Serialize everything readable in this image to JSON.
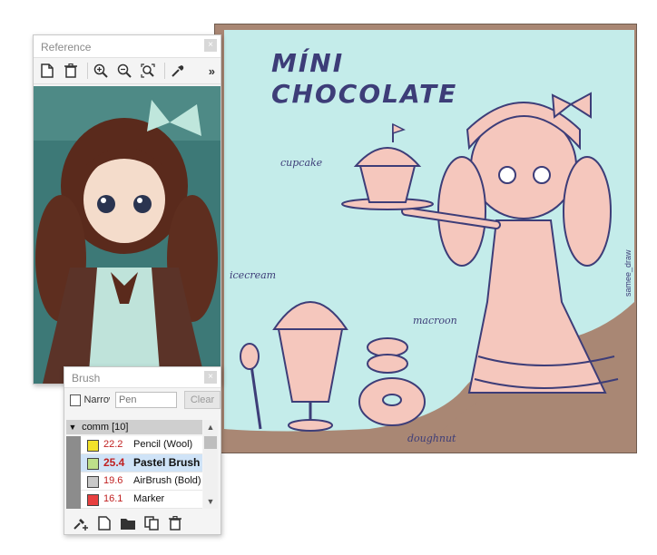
{
  "reference_panel": {
    "title": "Reference",
    "close": "×",
    "toolbar": {
      "icons": [
        "new-page-icon",
        "delete-icon",
        "zoom-in-icon",
        "zoom-out-icon",
        "fit-view-icon",
        "eyedropper-icon"
      ],
      "more": "»"
    }
  },
  "brush_panel": {
    "title": "Brush",
    "close": "×",
    "narrow_label": "Narrow",
    "search_value": "Pen",
    "clear_label": "Clear",
    "group": "comm [10]",
    "items": [
      {
        "size": "22.2",
        "name": "Pencil (Wool)",
        "color": "#f2e22a",
        "selected": false
      },
      {
        "size": "25.4",
        "name": "Pastel Brush",
        "color": "#bde08a",
        "selected": true
      },
      {
        "size": "19.6",
        "name": "AirBrush (Bold)",
        "color": "#c8c8c8",
        "selected": false
      },
      {
        "size": "16.1",
        "name": "Marker",
        "color": "#e84040",
        "selected": false
      }
    ],
    "bottom_icons": [
      "add-brush-icon",
      "new-file-icon",
      "folder-icon",
      "duplicate-icon",
      "delete-icon"
    ]
  },
  "artwork": {
    "title_line1": "MÍNI",
    "title_line2": "CHOCOLATE",
    "labels": {
      "cupcake": "cupcake",
      "icecream": "icecream",
      "macroon": "macroon",
      "doughnut": "doughnut"
    },
    "signature": "samee_draw"
  },
  "colors": {
    "canvas_frame": "#a98774",
    "canvas_background": "#c4ecea",
    "line_art": "#3d3d78",
    "character_fill": "#f5c7bd"
  }
}
